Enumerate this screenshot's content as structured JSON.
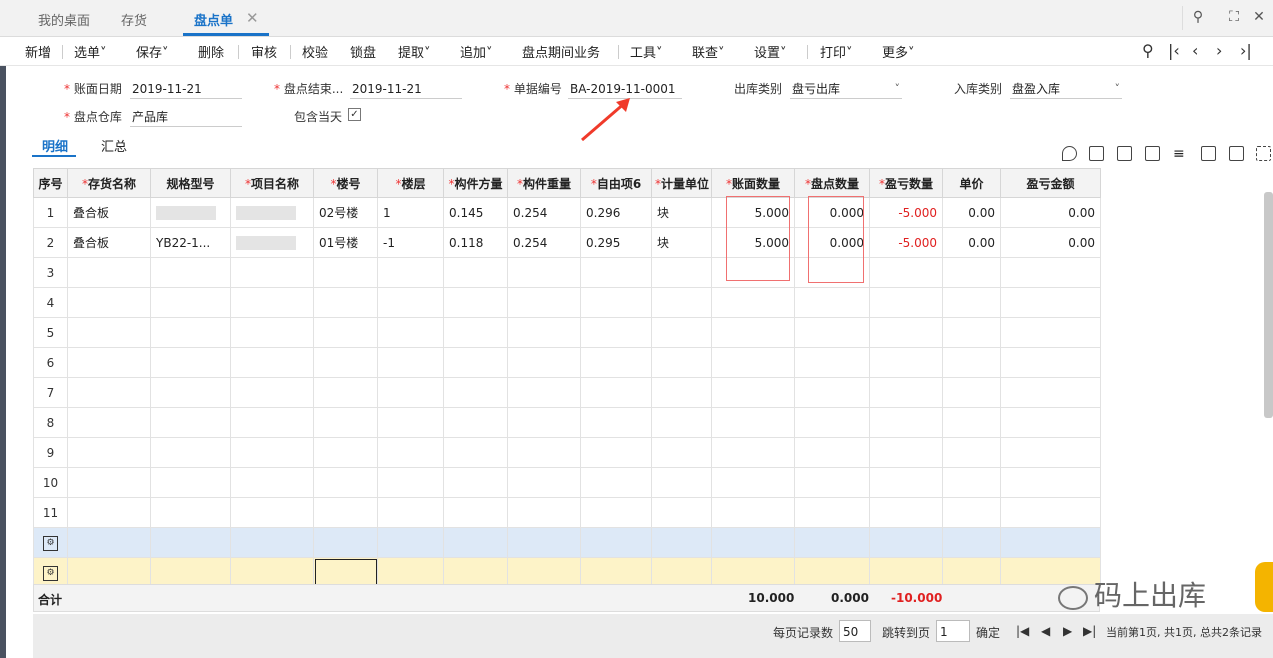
{
  "tabs": [
    {
      "label": "我的桌面"
    },
    {
      "label": "存货"
    },
    {
      "label": "盘点单"
    }
  ],
  "window_icons": {
    "search": "search-icon",
    "fullscreen": "fullscreen-icon",
    "close": "close-icon"
  },
  "toolbar": {
    "new": "新增",
    "select": "选单",
    "save": "保存",
    "delete": "删除",
    "audit": "审核",
    "verify": "校验",
    "lock": "锁盘",
    "extract": "提取",
    "append": "追加",
    "period": "盘点期间业务",
    "tools": "工具",
    "query": "联查",
    "settings": "设置",
    "print": "打印",
    "more": "更多"
  },
  "form": {
    "book_date_label": "账面日期",
    "book_date": "2019-11-21",
    "end_label": "盘点结束...",
    "end_date": "2019-11-21",
    "docno_label": "单据编号",
    "docno": "BA-2019-11-0001",
    "out_type_label": "出库类别",
    "out_type": "盘亏出库",
    "in_type_label": "入库类别",
    "in_type": "盘盈入库",
    "warehouse_label": "盘点仓库",
    "warehouse": "产品库",
    "include_today_label": "包含当天",
    "include_today_checked": true
  },
  "subtabs": {
    "detail": "明细",
    "summary": "汇总"
  },
  "grid": {
    "headers": [
      {
        "text": "序号",
        "req": false
      },
      {
        "text": "存货名称",
        "req": true
      },
      {
        "text": "规格型号",
        "req": false
      },
      {
        "text": "项目名称",
        "req": true
      },
      {
        "text": "楼号",
        "req": true
      },
      {
        "text": "楼层",
        "req": true
      },
      {
        "text": "构件方量",
        "req": true
      },
      {
        "text": "构件重量",
        "req": true
      },
      {
        "text": "自由项6",
        "req": true
      },
      {
        "text": "计量单位",
        "req": true
      },
      {
        "text": "账面数量",
        "req": true
      },
      {
        "text": "盘点数量",
        "req": true
      },
      {
        "text": "盈亏数量",
        "req": true
      },
      {
        "text": "单价",
        "req": false
      },
      {
        "text": "盈亏金额",
        "req": false
      }
    ],
    "rows": [
      {
        "idx": "1",
        "name": "叠合板",
        "spec": "",
        "project": "",
        "building": "02号楼",
        "floor": "1",
        "volume": "0.145",
        "weight": "0.254",
        "free6": "0.296",
        "unit": "块",
        "book_qty": "5.000",
        "count_qty": "0.000",
        "diff_qty": "-5.000",
        "price": "0.00",
        "diff_amt": "0.00"
      },
      {
        "idx": "2",
        "name": "叠合板",
        "spec": "YB22-1...",
        "project": "",
        "building": "01号楼",
        "floor": "-1",
        "volume": "0.118",
        "weight": "0.254",
        "free6": "0.295",
        "unit": "块",
        "book_qty": "5.000",
        "count_qty": "0.000",
        "diff_qty": "-5.000",
        "price": "0.00",
        "diff_amt": "0.00"
      }
    ],
    "empty_rows": [
      "3",
      "4",
      "5",
      "6",
      "7",
      "8",
      "9",
      "10",
      "11"
    ]
  },
  "totals": {
    "label": "合计",
    "book_qty": "10.000",
    "count_qty": "0.000",
    "diff_qty": "-10.000"
  },
  "pager": {
    "per_page_label": "每页记录数",
    "per_page": "50",
    "jump_label": "跳转到页",
    "jump_page": "1",
    "confirm": "确定",
    "status": "当前第1页, 共1页, 总共2条记录"
  },
  "watermark": "码上出库",
  "colors": {
    "accent": "#1a73c8",
    "required": "#e33333",
    "negative": "#e02020",
    "highlight_box": "#f07070"
  }
}
